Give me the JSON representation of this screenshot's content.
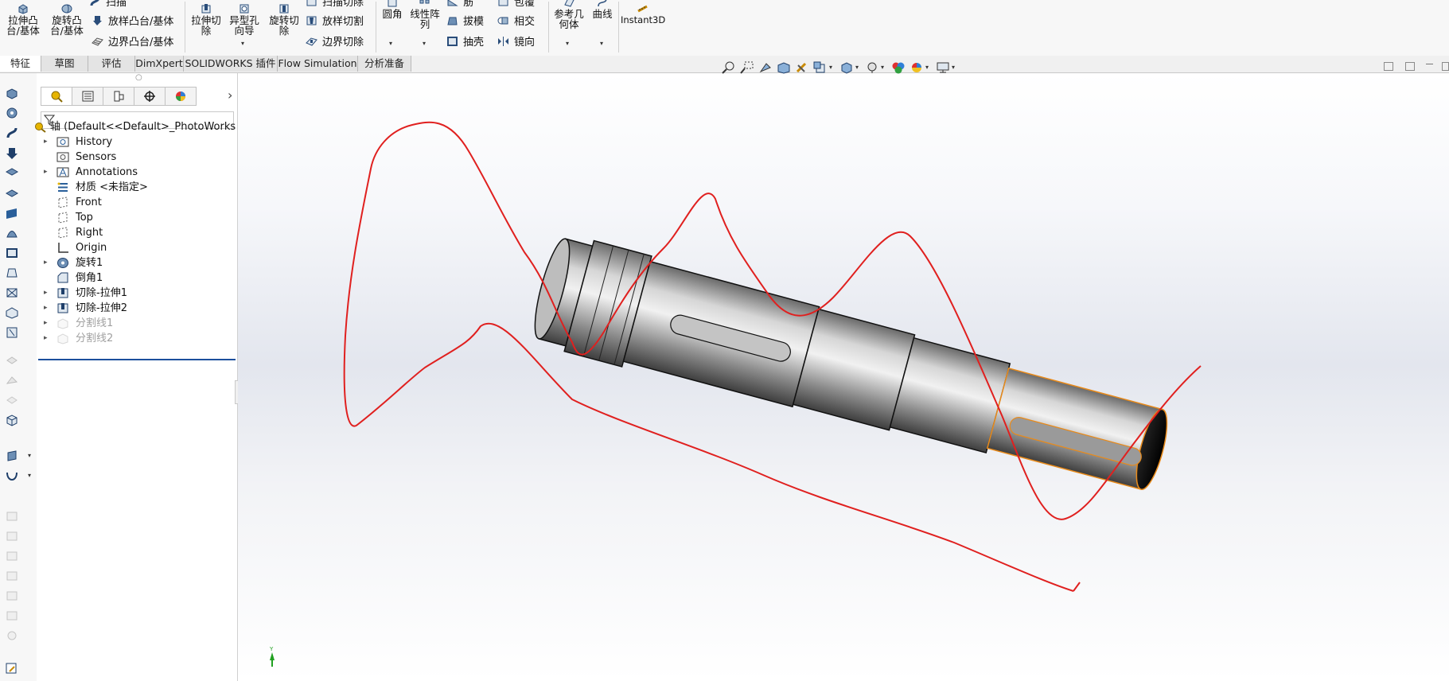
{
  "ribbon": {
    "extrude_boss": "拉伸凸\n台/基体",
    "revolve_boss": "旋转凸\n台/基体",
    "sweep": "扫描",
    "loft_boss": "放样凸台/基体",
    "boundary_boss": "边界凸台/基体",
    "extrude_cut": "拉伸切\n除",
    "hole_wizard": "异型孔\n向导",
    "revolve_cut": "旋转切\n除",
    "sweep_cut": "扫描切除",
    "loft_cut": "放样切割",
    "boundary_cut": "边界切除",
    "fillet": "圆角",
    "linear_pattern": "线性阵\n列",
    "rib": "筋",
    "draft": "拔模",
    "shell": "抽壳",
    "wrap": "包覆",
    "intersect": "相交",
    "mirror": "镜向",
    "reference_geometry": "参考几\n何体",
    "curves": "曲线",
    "instant3d": "Instant3D"
  },
  "tabs": [
    "特征",
    "草图",
    "评估",
    "DimXpert",
    "SOLIDWORKS 插件",
    "Flow Simulation",
    "分析准备"
  ],
  "feature_tree": {
    "root": "轴  (Default<<Default>_PhotoWorks D",
    "items": [
      {
        "label": "History",
        "expand": true,
        "dim": false,
        "icon": "history-icon"
      },
      {
        "label": "Sensors",
        "expand": false,
        "dim": false,
        "icon": "sensors-icon"
      },
      {
        "label": "Annotations",
        "expand": true,
        "dim": false,
        "icon": "annotations-icon"
      },
      {
        "label": "材质 <未指定>",
        "expand": false,
        "dim": false,
        "icon": "material-icon"
      },
      {
        "label": "Front",
        "expand": false,
        "dim": false,
        "icon": "plane-icon"
      },
      {
        "label": "Top",
        "expand": false,
        "dim": false,
        "icon": "plane-icon"
      },
      {
        "label": "Right",
        "expand": false,
        "dim": false,
        "icon": "plane-icon"
      },
      {
        "label": "Origin",
        "expand": false,
        "dim": false,
        "icon": "origin-icon"
      },
      {
        "label": "旋转1",
        "expand": true,
        "dim": false,
        "icon": "revolve-feature-icon"
      },
      {
        "label": "倒角1",
        "expand": false,
        "dim": false,
        "icon": "chamfer-feature-icon"
      },
      {
        "label": "切除-拉伸1",
        "expand": true,
        "dim": false,
        "icon": "cut-extrude-feature-icon"
      },
      {
        "label": "切除-拉伸2",
        "expand": true,
        "dim": false,
        "icon": "cut-extrude-feature-icon"
      },
      {
        "label": "分割线1",
        "expand": true,
        "dim": true,
        "icon": "split-line-icon"
      },
      {
        "label": "分割线2",
        "expand": true,
        "dim": true,
        "icon": "split-line-icon"
      }
    ]
  },
  "colors": {
    "sketch_line": "#e0201f",
    "selection": "#e88a1a",
    "rollback_bar": "#1c4f9c"
  }
}
